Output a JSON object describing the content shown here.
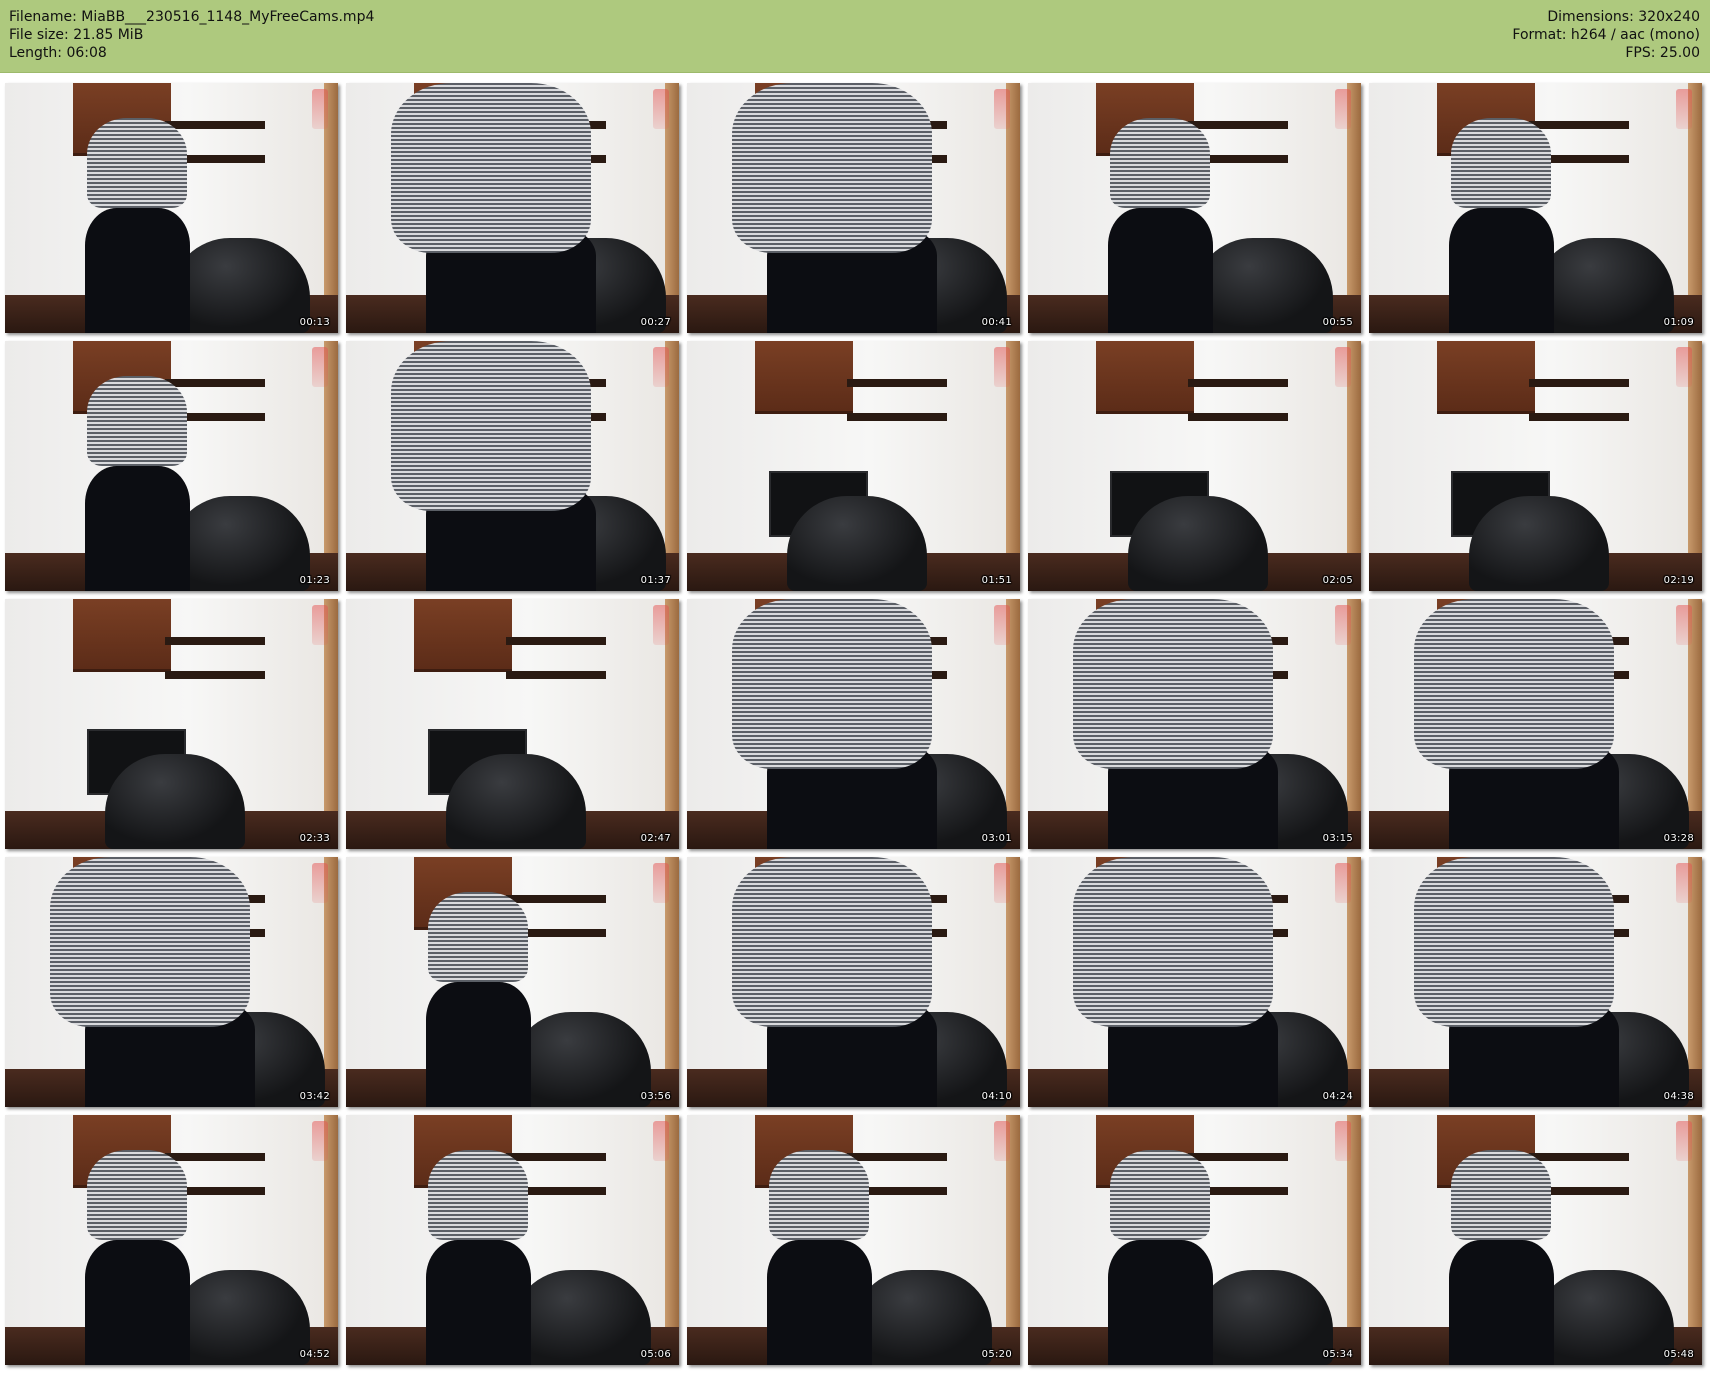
{
  "info": {
    "filename": "Filename: MiaBB___230516_1148_MyFreeCams.mp4",
    "filesize": "File size: 21.85 MiB",
    "length": "Length: 06:08",
    "dimensions": "Dimensions: 320x240",
    "format": "Format: h264 / aac (mono)",
    "fps": "FPS: 25.00"
  },
  "colors": {
    "header_background": "#aec97e"
  },
  "thumbnails": [
    {
      "time": "00:13",
      "scene": "person"
    },
    {
      "time": "00:27",
      "scene": "person-close"
    },
    {
      "time": "00:41",
      "scene": "person-close"
    },
    {
      "time": "00:55",
      "scene": "person"
    },
    {
      "time": "01:09",
      "scene": "person"
    },
    {
      "time": "01:23",
      "scene": "person"
    },
    {
      "time": "01:37",
      "scene": "person-close"
    },
    {
      "time": "01:51",
      "scene": "room"
    },
    {
      "time": "02:05",
      "scene": "room"
    },
    {
      "time": "02:19",
      "scene": "room"
    },
    {
      "time": "02:33",
      "scene": "room"
    },
    {
      "time": "02:47",
      "scene": "room"
    },
    {
      "time": "03:01",
      "scene": "person-close"
    },
    {
      "time": "03:15",
      "scene": "person-close"
    },
    {
      "time": "03:28",
      "scene": "person-close"
    },
    {
      "time": "03:42",
      "scene": "person-close"
    },
    {
      "time": "03:56",
      "scene": "person"
    },
    {
      "time": "04:10",
      "scene": "person-close"
    },
    {
      "time": "04:24",
      "scene": "person-close"
    },
    {
      "time": "04:38",
      "scene": "person-close"
    },
    {
      "time": "04:52",
      "scene": "person"
    },
    {
      "time": "05:06",
      "scene": "person"
    },
    {
      "time": "05:20",
      "scene": "person"
    },
    {
      "time": "05:34",
      "scene": "person"
    },
    {
      "time": "05:48",
      "scene": "person"
    }
  ]
}
